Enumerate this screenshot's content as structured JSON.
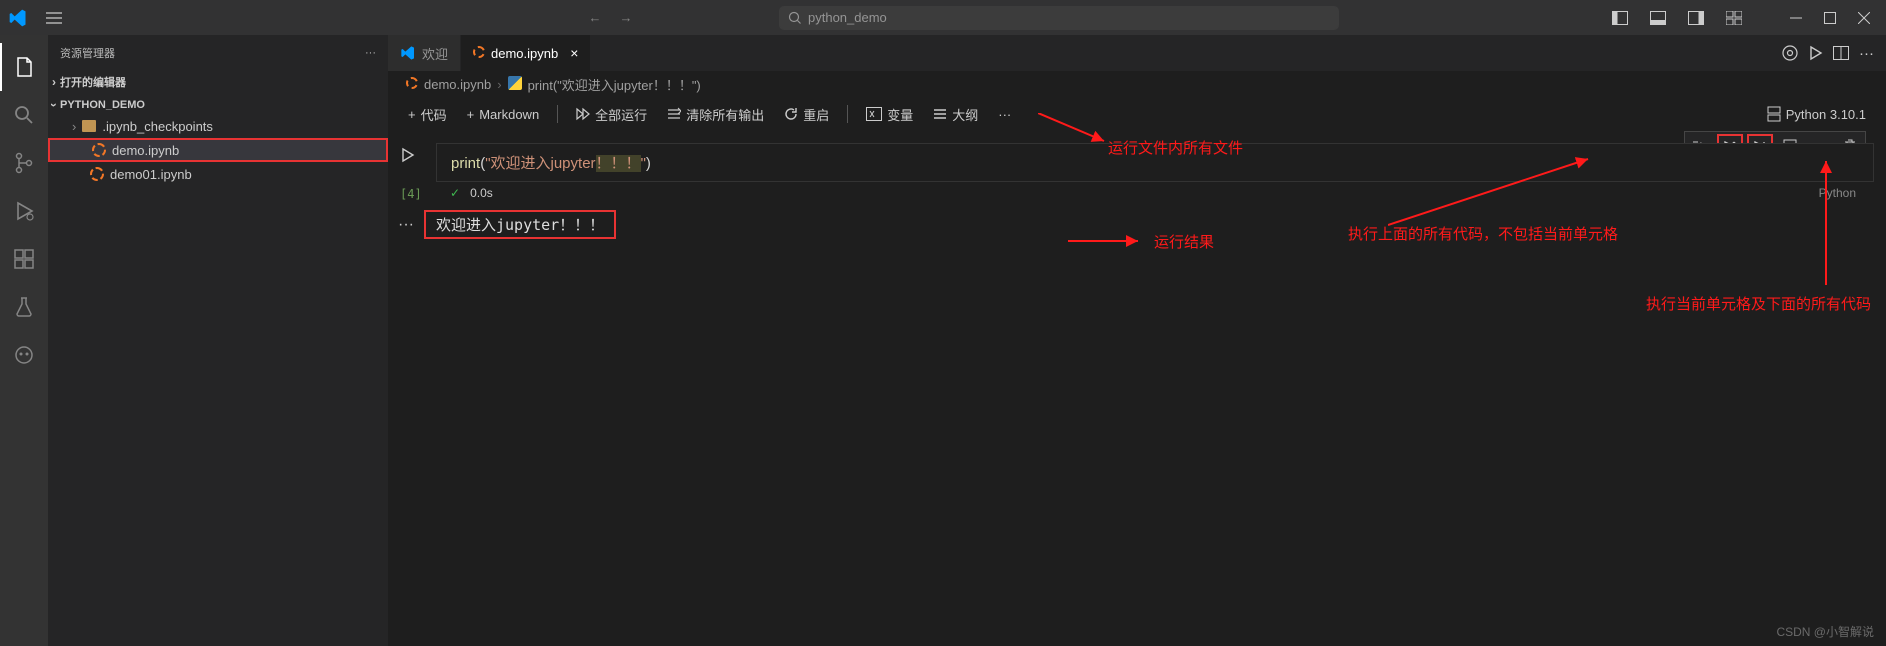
{
  "titlebar": {
    "search_text": "python_demo"
  },
  "sidebar": {
    "title": "资源管理器",
    "open_editors": "打开的编辑器",
    "workspace": "PYTHON_DEMO",
    "items": [
      {
        "label": ".ipynb_checkpoints",
        "type": "folder"
      },
      {
        "label": "demo.ipynb",
        "type": "notebook"
      },
      {
        "label": "demo01.ipynb",
        "type": "notebook"
      }
    ]
  },
  "tabs": {
    "welcome": "欢迎",
    "active": "demo.ipynb"
  },
  "breadcrumb": {
    "file": "demo.ipynb",
    "cell": "print(\"欢迎进入jupyter！！！\")"
  },
  "nb_toolbar": {
    "code": "代码",
    "markdown": "Markdown",
    "run_all": "全部运行",
    "clear": "清除所有输出",
    "restart": "重启",
    "variables": "变量",
    "outline": "大纲",
    "kernel": "Python 3.10.1"
  },
  "cell": {
    "exec_count": "[4]",
    "code_fn": "print",
    "code_open": "(",
    "code_str1": "\"欢迎进入jupyter",
    "code_hl": "！！！",
    "code_str2": "\"",
    "code_close": ")",
    "duration": "0.0s",
    "lang": "Python",
    "output": "欢迎进入jupyter！！！"
  },
  "annotations": {
    "run_all": "运行文件内所有文件",
    "output": "运行结果",
    "exec_above": "执行上面的所有代码，不包括当前单元格",
    "exec_below": "执行当前单元格及下面的所有代码"
  },
  "watermark": "CSDN @小智解说"
}
